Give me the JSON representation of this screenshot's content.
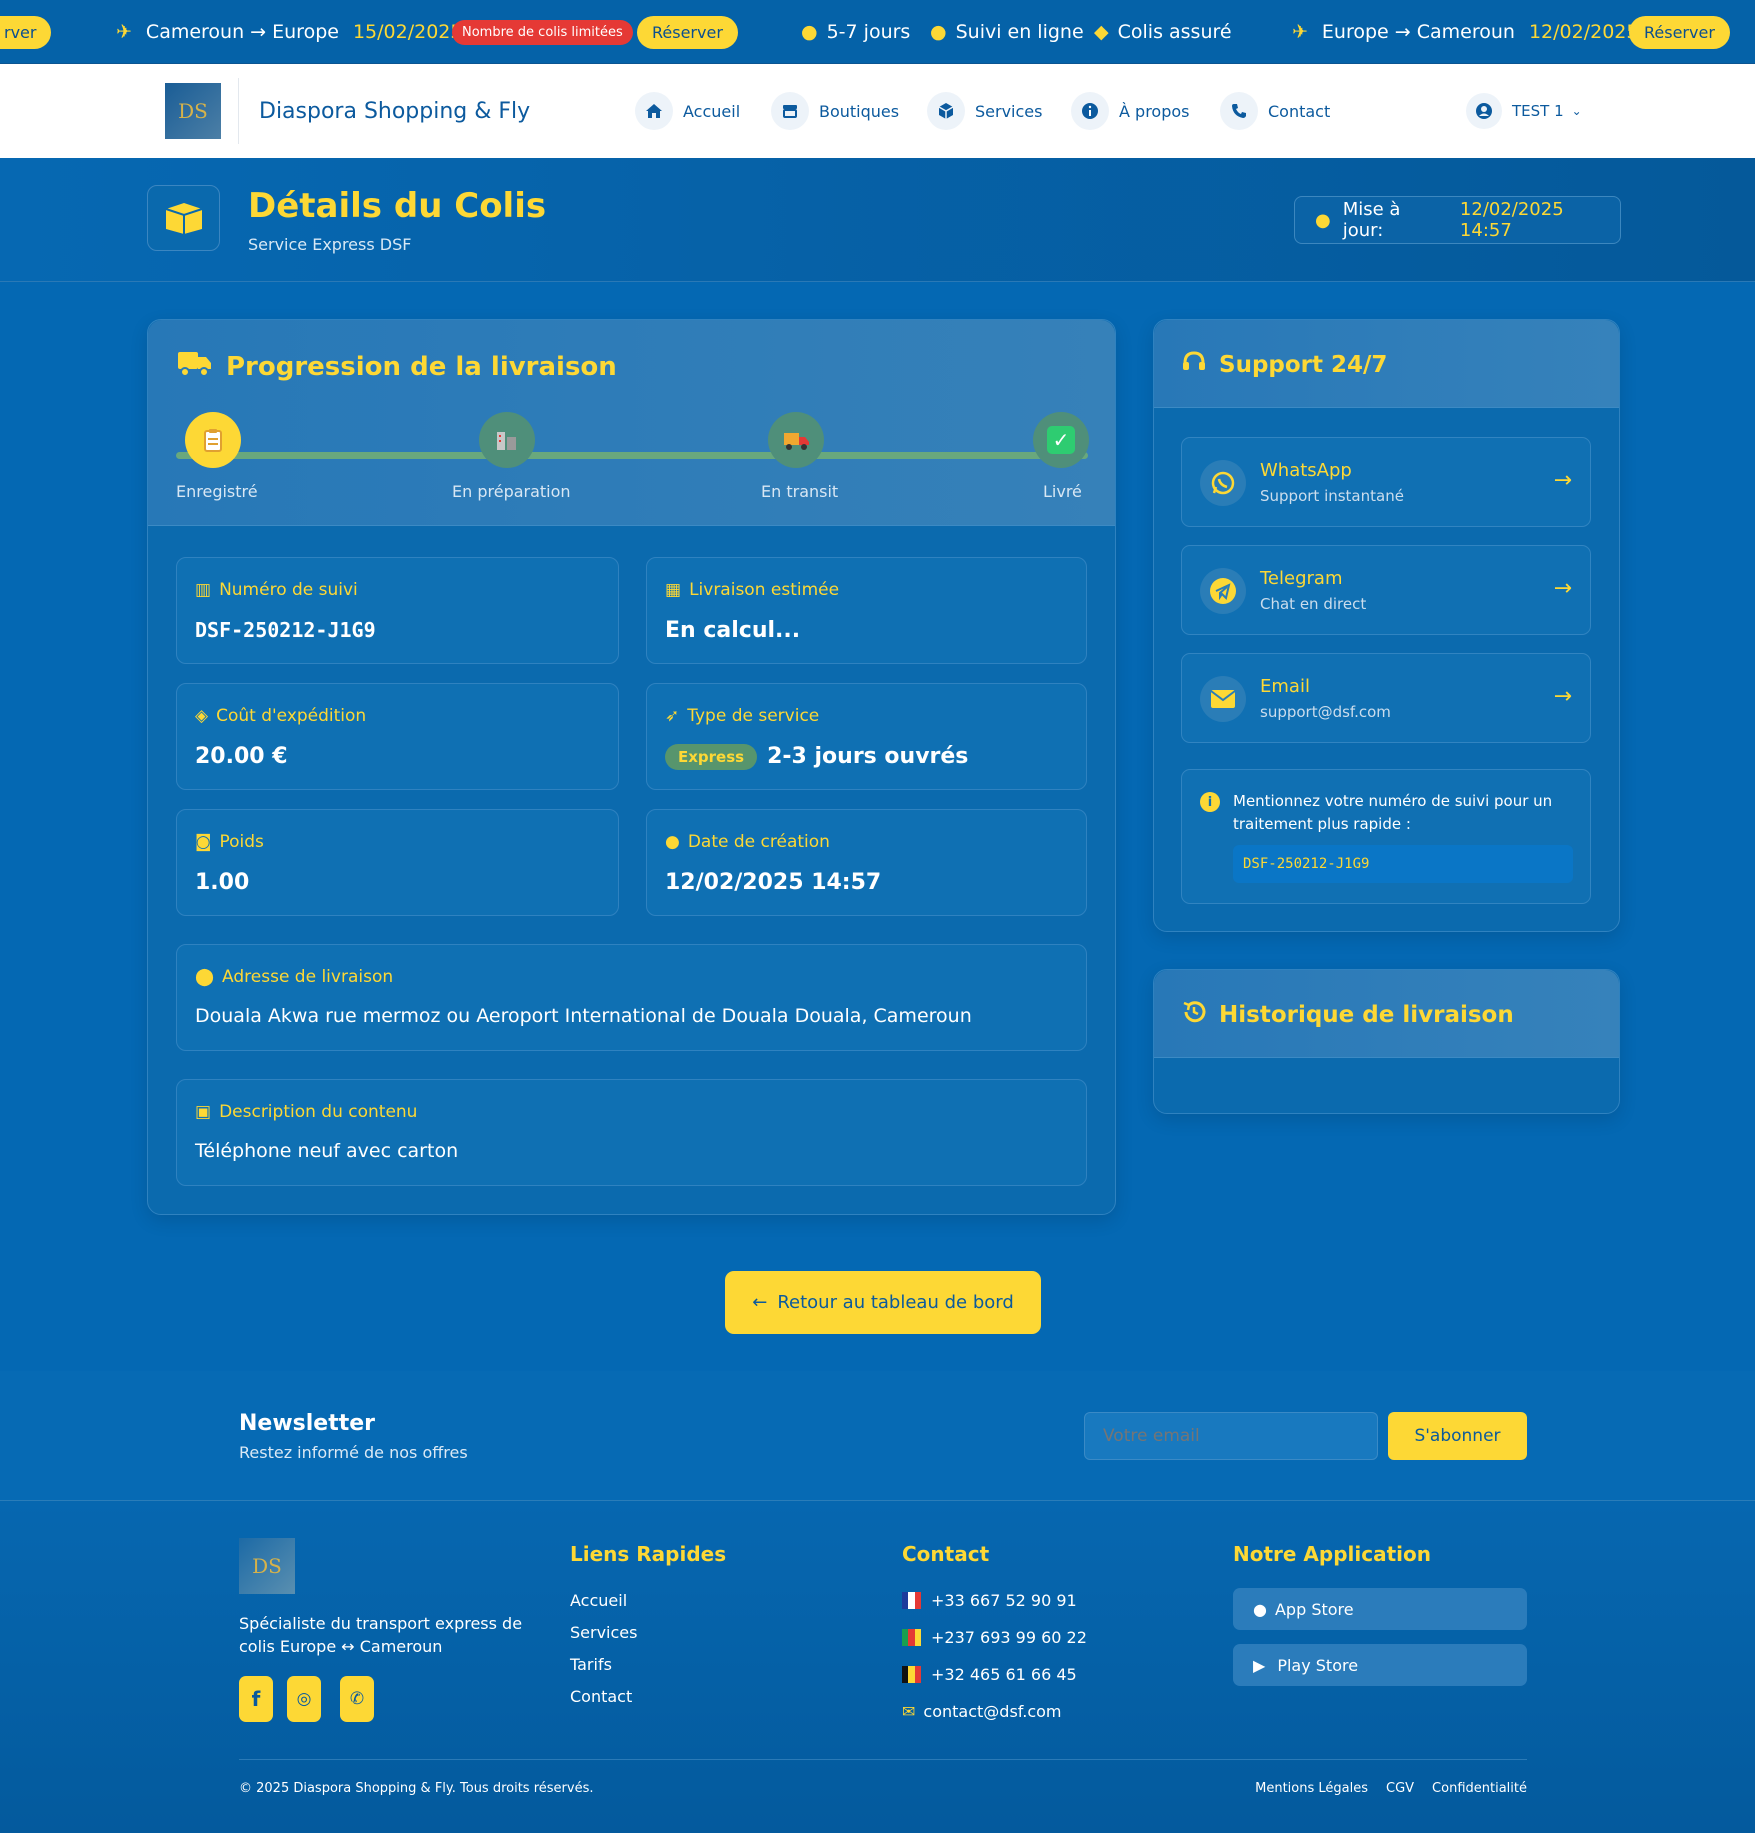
{
  "ticker": {
    "partial_reserve": "rver",
    "route1": "Cameroun → Europe",
    "date1": "15/02/2025",
    "limited": "Nombre de colis limitées",
    "reserve1": "Réserver",
    "feature1": "5-7 jours",
    "feature2": "Suivi en ligne",
    "feature3": "Colis assuré",
    "route2": "Europe → Cameroun",
    "date2": "12/02/2025",
    "reserve2": "Réserver"
  },
  "nav": {
    "logo_text": "DS",
    "brand": "Diaspora Shopping & Fly",
    "items": [
      "Accueil",
      "Boutiques",
      "Services",
      "À propos",
      "Contact"
    ],
    "user": "TEST 1"
  },
  "page": {
    "title": "Détails du Colis",
    "subtitle": "Service Express DSF",
    "updated_label": "Mise à jour:",
    "updated_value": "12/02/2025 14:57"
  },
  "progress": {
    "title": "Progression de la livraison",
    "steps": [
      "Enregistré",
      "En préparation",
      "En transit",
      "Livré"
    ]
  },
  "details": {
    "tracking_label": "Numéro de suivi",
    "tracking_value": "DSF-250212-J1G9",
    "delivery_label": "Livraison estimée",
    "delivery_value": "En calcul...",
    "cost_label": "Coût d'expédition",
    "cost_value": "20.00 €",
    "service_label": "Type de service",
    "service_badge": "Express",
    "service_value": "2-3 jours ouvrés",
    "weight_label": "Poids",
    "weight_value": "1.00",
    "created_label": "Date de création",
    "created_value": "12/02/2025 14:57",
    "address_label": "Adresse de livraison",
    "address_value": "Douala Akwa rue mermoz ou Aeroport International de Douala Douala, Cameroun",
    "content_label": "Description du contenu",
    "content_value": "Téléphone neuf avec carton"
  },
  "support": {
    "title": "Support 24/7",
    "items": [
      {
        "title": "WhatsApp",
        "sub": "Support instantané"
      },
      {
        "title": "Telegram",
        "sub": "Chat en direct"
      },
      {
        "title": "Email",
        "sub": "support@dsf.com"
      }
    ],
    "note": "Mentionnez votre numéro de suivi pour un traitement plus rapide :",
    "note_code": "DSF-250212-J1G9"
  },
  "history": {
    "title": "Historique de livraison"
  },
  "back_button": "Retour au tableau de bord",
  "newsletter": {
    "title": "Newsletter",
    "sub": "Restez informé de nos offres",
    "placeholder": "Votre email",
    "button": "S'abonner"
  },
  "footer": {
    "about": "Spécialiste du transport express de colis Europe ↔ Cameroun",
    "links_title": "Liens Rapides",
    "links": [
      "Accueil",
      "Services",
      "Tarifs",
      "Contact"
    ],
    "contact_title": "Contact",
    "phones": [
      "+33 667 52 90 91",
      "+237 693 99 60 22",
      "+32 465 61 66 45"
    ],
    "email": "contact@dsf.com",
    "app_title": "Notre Application",
    "app_store": "App Store",
    "play_store": "Play Store",
    "copyright": "© 2025 Diaspora Shopping & Fly. Tous droits réservés.",
    "legal": [
      "Mentions Légales",
      "CGV",
      "Confidentialité"
    ]
  }
}
